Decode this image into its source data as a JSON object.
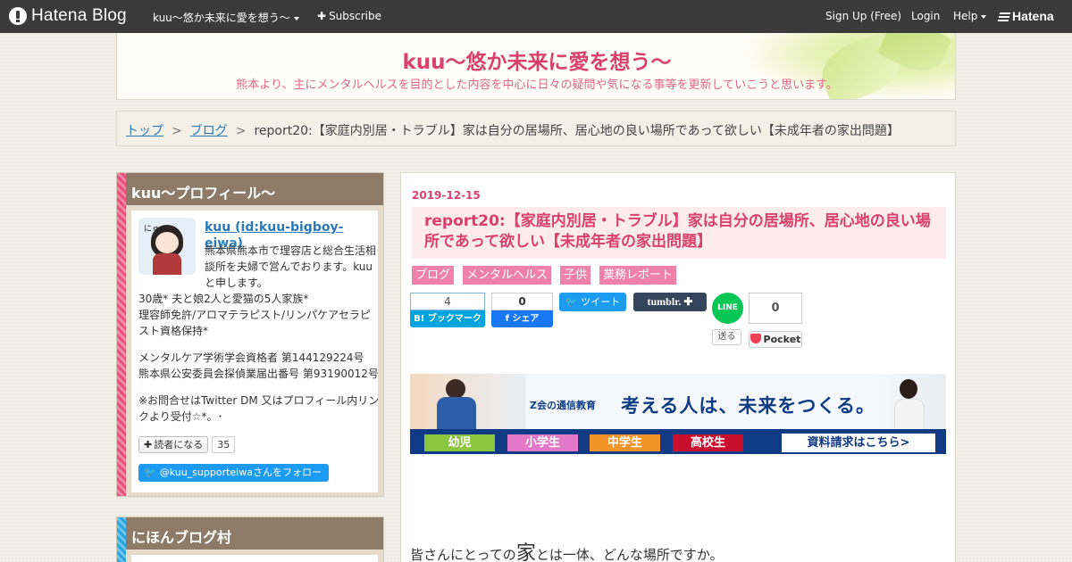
{
  "topbar": {
    "logo": "Hatena Blog",
    "blog_name": "kuu～悠か未来に愛を想う～",
    "subscribe": "Subscribe",
    "signup": "Sign Up (Free)",
    "login": "Login",
    "help": "Help",
    "hatena": "Hatena"
  },
  "header": {
    "title": "kuu～悠か未来に愛を想う～",
    "description": "熊本より、主にメンタルヘルスを目的とした内容を中心に日々の疑問や気になる事等を更新していこうと思います。"
  },
  "breadcrumb": {
    "items": [
      "トップ",
      "ブログ"
    ],
    "separator": ">",
    "current": "report20:【家庭内別居・トラブル】家は自分の居場所、居心地の良い場所であって欲しい【未成年者の家出問題】"
  },
  "sidebar": {
    "profile": {
      "heading": "kuu～プロフィール～",
      "avatar_text": "にゅぅ",
      "username": "kuu (id:kuu-bigboy-eiwa)",
      "intro": "熊本県熊本市で理容店と総合生活相談所を夫婦で営んでおります。kuuと申します。",
      "intro2": "30歳* 夫と娘2人と愛猫の5人家族*\n理容師免許/アロマテラピスト/リンパケアセラピスト資格保持*",
      "intro3": "メンタルケア学術学会資格者 第144129224号\n熊本県公安委員会探偵業届出番号 第93190012号",
      "intro4": "※お問合せはTwitter DM 又はプロフィール内リンクより受付☆*。･",
      "reader_button": "読者になる",
      "reader_count": "35",
      "twitter_follow": "@kuu_supporteiwaさんをフォロー"
    },
    "village": {
      "heading": "にほんブログ村"
    }
  },
  "post": {
    "date": "2019-12-15",
    "title": "report20:【家庭内別居・トラブル】家は自分の居場所、居心地の良い場所であって欲しい【未成年者の家出問題】",
    "categories": [
      "ブログ",
      "メンタルヘルス",
      "子供",
      "業務レポート"
    ],
    "share": {
      "hatena_count": "4",
      "hatena_label": "B! ブックマーク",
      "facebook_count": "0",
      "facebook_label": "シェア",
      "tweet_label": "ツイート",
      "tumblr_label": "tumblr. ✚",
      "line_label": "LINE",
      "line_send": "送る",
      "pocket_count": "0",
      "pocket_label": "Pocket"
    },
    "banner": {
      "brand": "Z会の通信教育",
      "slogan": "考える人は、未来をつくる。",
      "buttons": [
        "幼児",
        "小学生",
        "中学生",
        "高校生"
      ],
      "request": "資料請求はこちら>"
    },
    "paragraph_pre": "皆さんにとっての",
    "paragraph_big": "家",
    "paragraph_post": "とは一体、どんな場所ですか。"
  }
}
